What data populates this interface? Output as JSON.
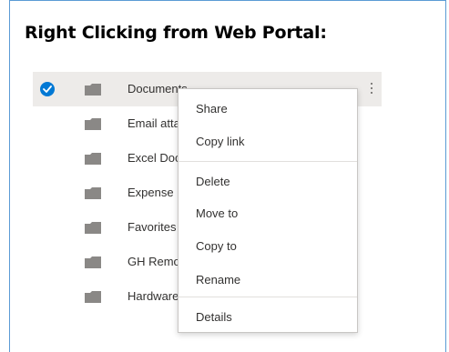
{
  "heading": "Right Clicking from Web Portal:",
  "files": [
    {
      "name": "Documents",
      "selected": true
    },
    {
      "name": "Email atta",
      "selected": false
    },
    {
      "name": "Excel Doc",
      "selected": false
    },
    {
      "name": "Expense F",
      "selected": false
    },
    {
      "name": "Favorites",
      "selected": false
    },
    {
      "name": "GH Remo",
      "selected": false
    },
    {
      "name": "Hardware",
      "selected": false
    }
  ],
  "context_menu": {
    "items": [
      {
        "label": "Share"
      },
      {
        "label": "Copy link"
      },
      {
        "label": "Delete"
      },
      {
        "label": "Move to"
      },
      {
        "label": "Copy to"
      },
      {
        "label": "Rename"
      },
      {
        "label": "Details"
      }
    ]
  },
  "colors": {
    "frame_border": "#5b9bd5",
    "selected_row": "#edebe9",
    "check_accent": "#0078d4",
    "folder_gray": "#8a8886"
  }
}
